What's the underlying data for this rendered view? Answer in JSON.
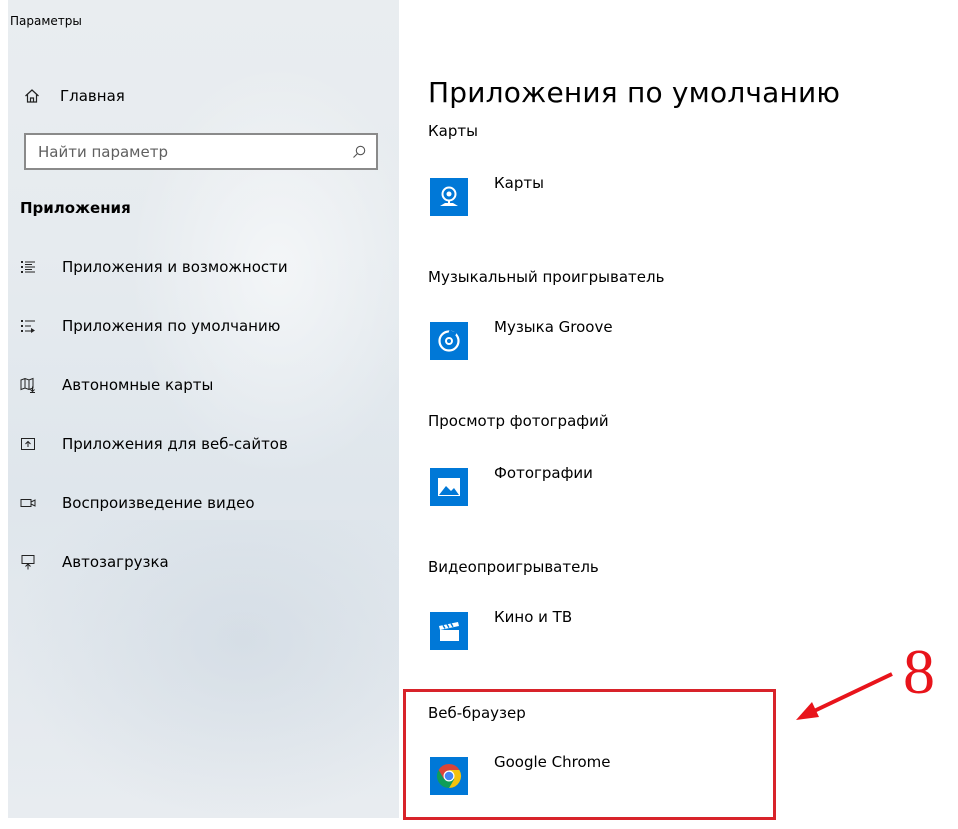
{
  "window": {
    "title": "Параметры"
  },
  "sidebar": {
    "home_label": "Главная",
    "search_placeholder": "Найти параметр",
    "section_heading": "Приложения",
    "items": [
      {
        "label": "Приложения и возможности",
        "icon": "apps-features-icon"
      },
      {
        "label": "Приложения по умолчанию",
        "icon": "default-apps-icon"
      },
      {
        "label": "Автономные карты",
        "icon": "offline-maps-icon"
      },
      {
        "label": "Приложения для веб-сайтов",
        "icon": "apps-for-websites-icon"
      },
      {
        "label": "Воспроизведение видео",
        "icon": "video-playback-icon"
      },
      {
        "label": "Автозагрузка",
        "icon": "startup-icon"
      }
    ]
  },
  "main": {
    "title": "Приложения по умолчанию",
    "categories": [
      {
        "label": "Карты",
        "app": "Карты",
        "icon": "maps-app-icon"
      },
      {
        "label": "Музыкальный проигрыватель",
        "app": "Музыка Groove",
        "icon": "groove-music-icon"
      },
      {
        "label": "Просмотр фотографий",
        "app": "Фотографии",
        "icon": "photos-app-icon"
      },
      {
        "label": "Видеопроигрыватель",
        "app": "Кино и ТВ",
        "icon": "movies-tv-icon"
      },
      {
        "label": "Веб-браузер",
        "app": "Google Chrome",
        "icon": "chrome-icon"
      }
    ]
  },
  "annotation": {
    "step_number": "8",
    "color": "#e8141b",
    "box_color": "#d8232a"
  },
  "colors": {
    "accent": "#0078d7"
  }
}
